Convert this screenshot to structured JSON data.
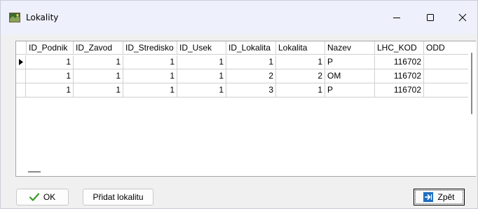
{
  "window": {
    "title": "Lokality"
  },
  "colors": {
    "ok_check": "#3c9a2c",
    "back_icon": "#1f6fc0"
  },
  "grid": {
    "columns": [
      "ID_Podnik",
      "ID_Zavod",
      "ID_Stredisko",
      "ID_Usek",
      "ID_Lokalita",
      "Lokalita",
      "Nazev",
      "LHC_KOD",
      "ODD"
    ],
    "rows": [
      [
        "1",
        "1",
        "1",
        "1",
        "1",
        "1",
        "P",
        "116702",
        ""
      ],
      [
        "1",
        "1",
        "1",
        "1",
        "2",
        "2",
        "OM",
        "116702",
        ""
      ],
      [
        "1",
        "1",
        "1",
        "1",
        "3",
        "1",
        "P",
        "116702",
        ""
      ]
    ],
    "current_row_icon": "current-row-arrow-icon"
  },
  "buttons": {
    "ok_label": "OK",
    "add_label": "Přidat lokalitu",
    "back_label": "Zpět"
  }
}
